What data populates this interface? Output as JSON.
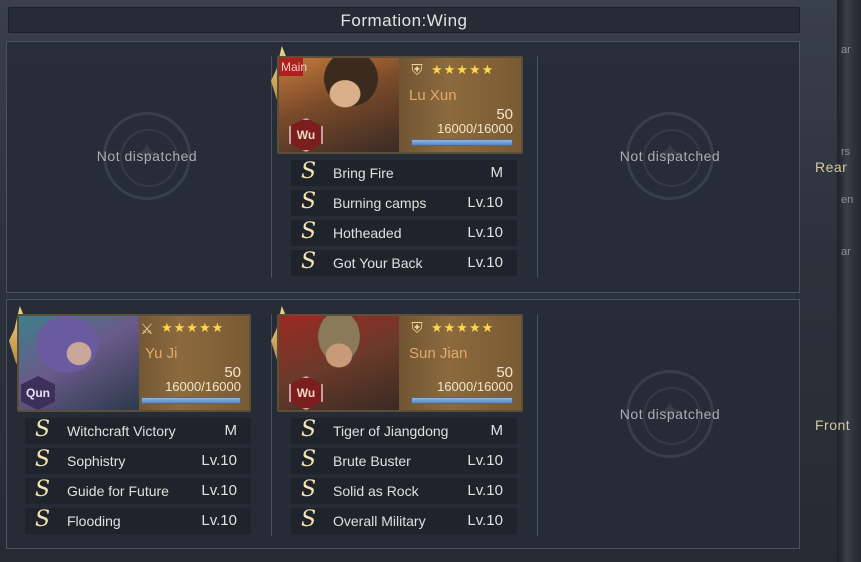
{
  "title": "Formation:Wing",
  "row_labels": {
    "rear": "Rear",
    "front": "Front"
  },
  "side_fragments": [
    "ar",
    "rs",
    "ar",
    "en"
  ],
  "empty_text": "Not dispatched",
  "heroes": {
    "lu_xun": {
      "name": "Lu Xun",
      "main_tag": "Main",
      "faction": "Wu",
      "stars": "★★★★★",
      "level": "50",
      "troops": "16000/16000",
      "troop_fill": 1.0,
      "skills": [
        {
          "icon": "S",
          "name": "Bring Fire",
          "level": "M"
        },
        {
          "icon": "S",
          "name": "Burning camps",
          "level": "Lv.10"
        },
        {
          "icon": "S",
          "name": "Hotheaded",
          "level": "Lv.10"
        },
        {
          "icon": "S",
          "name": "Got Your Back",
          "level": "Lv.10"
        }
      ]
    },
    "yu_ji": {
      "name": "Yu Ji",
      "faction": "Qun",
      "stars": "★★★★★",
      "level": "50",
      "troops": "16000/16000",
      "troop_fill": 1.0,
      "skills": [
        {
          "icon": "S",
          "name": "Witchcraft Victory",
          "level": "M"
        },
        {
          "icon": "S",
          "name": "Sophistry",
          "level": "Lv.10"
        },
        {
          "icon": "S",
          "name": "Guide for Future",
          "level": "Lv.10"
        },
        {
          "icon": "S",
          "name": "Flooding",
          "level": "Lv.10"
        }
      ]
    },
    "sun_jian": {
      "name": "Sun Jian",
      "faction": "Wu",
      "stars": "★★★★★",
      "level": "50",
      "troops": "16000/16000",
      "troop_fill": 1.0,
      "skills": [
        {
          "icon": "S",
          "name": "Tiger of Jiangdong",
          "level": "M"
        },
        {
          "icon": "S",
          "name": "Brute Buster",
          "level": "Lv.10"
        },
        {
          "icon": "S",
          "name": "Solid as Rock",
          "level": "Lv.10"
        },
        {
          "icon": "S",
          "name": "Overall Military",
          "level": "Lv.10"
        }
      ]
    }
  },
  "colors": {
    "accent_gold": "#ffd54a",
    "faction_wu": "#7a1e1e",
    "faction_qun": "#3c2f5a",
    "troop_bar": "#5588c6"
  }
}
